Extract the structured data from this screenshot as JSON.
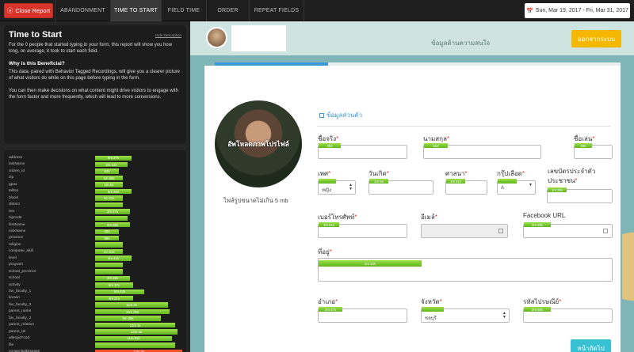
{
  "topbar": {
    "close_label": "Close Report",
    "close_icon": "arrow-left-circle-icon",
    "tabs": [
      "ABANDONMENT",
      "TIME TO START",
      "FIELD TIME",
      "ORDER",
      "REPEAT FIELDS"
    ],
    "active_tab": "TIME TO START",
    "date_range": "Sun, Mar 19, 2017 - Fri, Mar 31, 2017",
    "date_icon": "calendar-icon"
  },
  "panel": {
    "title": "Time to Start",
    "hide_link": "Hide Description",
    "intro": "For the 0 people that started typing in your form, this report will show you how long, on average, it took to start each field.",
    "why_title": "Why is this Beneficial?",
    "why_text": "This data, paired with Behavior Tagged Recordings, will give you a clearer picture of what visitors do while on this page before typing in the form.",
    "action_text": "You can then make decisions on what content might drive visitors to engage with the form faster and more frequently, which will lead to more conversions."
  },
  "fields": [
    {
      "name": "address",
      "time": "5m 27s",
      "pct": 0.2
    },
    {
      "name": "lastName",
      "time": "2m 14s",
      "pct": 0.18
    },
    {
      "name": "citizen_id",
      "time": "52s",
      "pct": 0.13
    },
    {
      "name": "zip",
      "time": "1m 28s",
      "pct": 0.15
    },
    {
      "name": "gpax",
      "time": "1m 5s",
      "pct": 0.15
    },
    {
      "name": "tellNo",
      "time": "5m 26s",
      "pct": 0.2
    },
    {
      "name": "blood",
      "time": "1m 11s",
      "pct": 0.15
    },
    {
      "name": "district",
      "time": "",
      "pct": 0.15
    },
    {
      "name": "sex",
      "time": "2m 47s",
      "pct": 0.19
    },
    {
      "name": "zipcode",
      "time": "",
      "pct": 0.18
    },
    {
      "name": "firstName",
      "time": "2m 58s",
      "pct": 0.19
    },
    {
      "name": "nickName",
      "time": "45s",
      "pct": 0.13
    },
    {
      "name": "province",
      "time": "59s",
      "pct": 0.13
    },
    {
      "name": "religion",
      "time": "",
      "pct": 0.15
    },
    {
      "name": "computer_skill",
      "time": "1m 21s",
      "pct": 0.15
    },
    {
      "name": "level",
      "time": "4m 41s",
      "pct": 0.2
    },
    {
      "name": "program",
      "time": "",
      "pct": 0.15
    },
    {
      "name": "school_province",
      "time": "",
      "pct": 0.15
    },
    {
      "name": "school",
      "time": "3m 29s",
      "pct": 0.19
    },
    {
      "name": "activity",
      "time": "5m 37s",
      "pct": 0.21
    },
    {
      "name": "fav_faculty_1",
      "time": "5m 43s",
      "pct": 0.27
    },
    {
      "name": "known",
      "time": "4m 21s",
      "pct": 0.21
    },
    {
      "name": "fav_faculty_3",
      "time": "11m 4s",
      "pct": 0.4
    },
    {
      "name": "parent_name",
      "time": "11m 25s",
      "pct": 0.41
    },
    {
      "name": "fav_faculty_2",
      "time": "9m 29s",
      "pct": 0.36
    },
    {
      "name": "parent_relation",
      "time": "12m 1s",
      "pct": 0.44
    },
    {
      "name": "parent_tel",
      "time": "12m 4s",
      "pct": 0.45
    },
    {
      "name": "allergicFood",
      "time": "11m 53s",
      "pct": 0.42
    },
    {
      "name": "file",
      "time": "",
      "pct": 0.44
    },
    {
      "name": "congenitalDisease",
      "time": "13m 3s",
      "pct": 0.48,
      "highlight": true
    }
  ],
  "app": {
    "header_step": "ข้อมูลด้านความสนใจ",
    "logout_label": "ออกจากระบบ",
    "progress_pct": 0.28,
    "photo_label": "อัพโหลดภาพโปรไฟล์",
    "photo_note": "ไฟล์รูปขนาดไม่เกิน 5 mb",
    "section_title": "ข้อมูลส่วนตัว",
    "next_label": "หน้าถัดไป",
    "form": {
      "first_name": {
        "label": "ชื่อจริง",
        "bar": "45s"
      },
      "last_name": {
        "label": "นามสกุล",
        "bar": "52s"
      },
      "nickname": {
        "label": "ชื่อเล่น",
        "bar": "59s"
      },
      "sex": {
        "label": "เพศ",
        "value": "หญิง",
        "bar": ""
      },
      "birthday": {
        "label": "วันเกิด",
        "bar": "1m 5s"
      },
      "religion": {
        "label": "ศาสนา",
        "bar": "1m 21s"
      },
      "blood": {
        "label": "กรุ๊ปเลือด",
        "value": "A",
        "bar": ""
      },
      "citizen": {
        "label": "เลขบัตรประจำตัวประชาชน",
        "bar": "1m 28s"
      },
      "tel": {
        "label": "เบอร์โทรศัพท์",
        "bar": "1m 51s"
      },
      "email": {
        "label": "อีเมล์",
        "bar": ""
      },
      "facebook": {
        "label": "Facebook URL",
        "bar": "2m 59s"
      },
      "address": {
        "label": "ที่อยู่",
        "bar": "2m 14s"
      },
      "district": {
        "label": "อำเภอ",
        "bar": "2m 47s"
      },
      "province": {
        "label": "จังหวัด",
        "value": "ชลบุรี",
        "bar": ""
      },
      "zipcode": {
        "label": "รหัสไปรษณีย์",
        "bar": "2m 58s"
      }
    }
  }
}
